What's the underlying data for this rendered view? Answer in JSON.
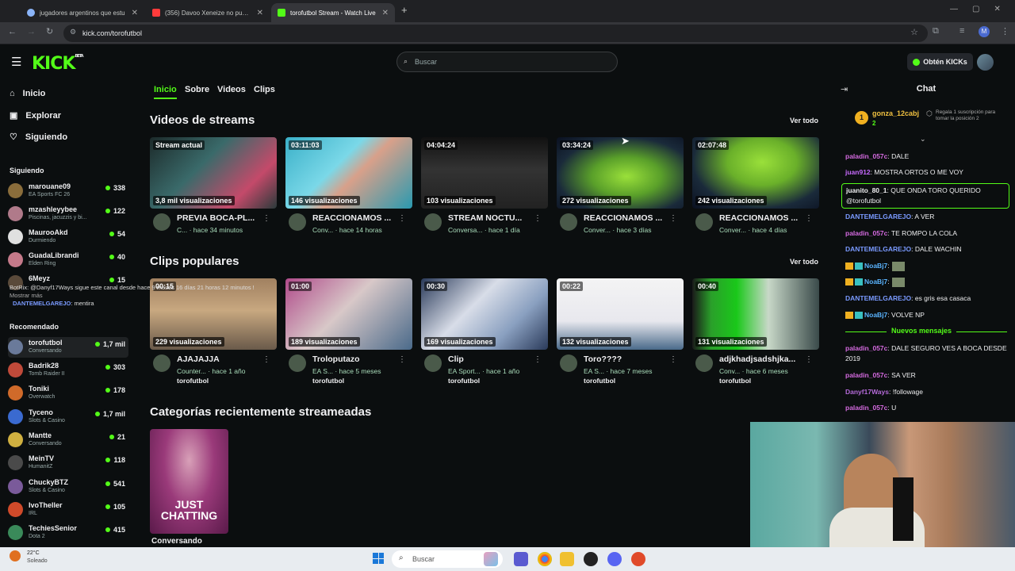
{
  "browser": {
    "tabs": [
      {
        "title": "jugadores argentinos que estu",
        "color": "#8ab4f8"
      },
      {
        "title": "(356) Davoo Xeneize no puede",
        "color": "#ff3b3b"
      },
      {
        "title": "torofutbol Stream - Watch Live",
        "color": "#53fc18"
      }
    ],
    "url": "kick.com/torofutbol"
  },
  "header": {
    "logo": "KICK",
    "beta": "BETA",
    "search_placeholder": "Buscar",
    "get_kicks": "Obtén KICKs"
  },
  "sidebar": {
    "nav": [
      {
        "label": "Inicio",
        "icon": "home-icon"
      },
      {
        "label": "Explorar",
        "icon": "compass-icon"
      },
      {
        "label": "Siguiendo",
        "icon": "heart-icon"
      }
    ],
    "following_title": "Siguiendo",
    "following": [
      {
        "name": "marouane09",
        "sub": "EA Sports FC 26",
        "viewers": "338",
        "color": "#8a6d3b"
      },
      {
        "name": "mzashleyybee",
        "sub": "Piscinas, jacuzzis y bi...",
        "viewers": "122",
        "color": "#b07a8a"
      },
      {
        "name": "MaurooAkd",
        "sub": "Durmiendo",
        "viewers": "54",
        "color": "#e0e0e0"
      },
      {
        "name": "GuadaLibrandi",
        "sub": "Elden Ring",
        "viewers": "40",
        "color": "#c57a8a"
      },
      {
        "name": "6Meyz",
        "sub": "",
        "viewers": "15",
        "color": "#5a4a3a"
      }
    ],
    "overlay_botrix": "BotRix: @Danyf17Ways sigue este canal desde hace 9 meses 16 días 21 horas 12 minutos !",
    "overlay_more": "Mostrar más",
    "overlay_user": "DANTEMELGAREJO",
    "overlay_text": ": mentira",
    "recommended_title": "Recomendado",
    "recommended": [
      {
        "name": "torofutbol",
        "sub": "Conversando",
        "viewers": "1,7 mil",
        "color": "#6a7a9a"
      },
      {
        "name": "Badrik28",
        "sub": "Tomb Raider II",
        "viewers": "303",
        "color": "#c04a3a"
      },
      {
        "name": "Toniki",
        "sub": "Overwatch",
        "viewers": "178",
        "color": "#d06a2a"
      },
      {
        "name": "Tyceno",
        "sub": "Slots & Casino",
        "viewers": "1,7 mil",
        "color": "#3a6ad0"
      },
      {
        "name": "Mantte",
        "sub": "Conversando",
        "viewers": "21",
        "color": "#d0b040"
      },
      {
        "name": "MeinTV",
        "sub": "HumanitZ",
        "viewers": "118",
        "color": "#4a4a4a"
      },
      {
        "name": "ChuckyBTZ",
        "sub": "Slots & Casino",
        "viewers": "541",
        "color": "#7a5a9a"
      },
      {
        "name": "IvoTheller",
        "sub": "IRL",
        "viewers": "105",
        "color": "#d04a2a"
      },
      {
        "name": "TechiesSenior",
        "sub": "Dota 2",
        "viewers": "415",
        "color": "#3a8a5a"
      }
    ]
  },
  "profile_tabs": [
    "Inicio",
    "Sobre",
    "Videos",
    "Clips"
  ],
  "videos_section": {
    "title": "Videos de streams",
    "see_all": "Ver todo",
    "items": [
      {
        "badge": "Stream actual",
        "views": "3,8 mil visualizaciones",
        "title": "PREVIA BOCA-PL...",
        "meta": "C... · hace 34 minutos",
        "bg": "linear-gradient(135deg,#1c2a2a 0%,#3a6a6a 40%,#c44a6a 75%,#2a3a3a 100%)"
      },
      {
        "badge": "03:11:03",
        "views": "146 visualizaciones",
        "title": "REACCIONAMOS ...",
        "meta": "Conv... · hace 14 horas",
        "bg": "linear-gradient(135deg,#3ab0c8 0%,#7ad8e8 40%,#d8a08a 55%,#2a9ab0 100%)"
      },
      {
        "badge": "04:04:24",
        "views": "103 visualizaciones",
        "title": "STREAM NOCTU...",
        "meta": "Conversa... · hace 1 día",
        "bg": "linear-gradient(180deg,#111 0%,#333 45%,#222 100%)"
      },
      {
        "badge": "03:34:24",
        "views": "272 visualizaciones",
        "title": "REACCIONAMOS ...",
        "meta": "Conver... · hace 3 días",
        "bg": "radial-gradient(ellipse at 55% 55%,#9ae03a 0%,#5aa02a 35%,#1a2a3a 70%,#0a1020 100%)"
      },
      {
        "badge": "02:07:48",
        "views": "242 visualizaciones",
        "title": "REACCIONAMOS ...",
        "meta": "Conver... · hace 4 días",
        "bg": "radial-gradient(ellipse at 55% 35%,#9ae03a 0%,#6ab02a 35%,#1a2a3a 70%,#0a1020 100%)"
      }
    ]
  },
  "clips_section": {
    "title": "Clips populares",
    "see_all": "Ver todo",
    "items": [
      {
        "badge": "00:15",
        "views": "229 visualizaciones",
        "title": "AJAJAJJA",
        "meta": "Counter... · hace 1 año",
        "user": "torofutbol",
        "bg": "linear-gradient(180deg,#a08060 0%,#c8a880 45%,#6a5a4a 100%)"
      },
      {
        "badge": "01:00",
        "views": "189 visualizaciones",
        "title": "Troloputazo",
        "meta": "EA S... · hace 5 meses",
        "user": "torofutbol",
        "bg": "linear-gradient(135deg,#b04a8a 0%,#d8c8c8 45%,#4a6a8a 100%)"
      },
      {
        "badge": "00:30",
        "views": "169 visualizaciones",
        "title": "Clip",
        "meta": "EA Sport... · hace 1 año",
        "user": "torofutbol",
        "bg": "linear-gradient(135deg,#2a3a5a 0%,#d8dde8 40%,#8aa0c0 70%,#2a3a5a 100%)"
      },
      {
        "badge": "00:22",
        "views": "132 visualizaciones",
        "title": "Toro????",
        "meta": "EA S... · hace 7 meses",
        "user": "torofutbol",
        "bg": "linear-gradient(180deg,#f4f4f4 0%,#e8e8ee 60%,#4a6a8a 100%)"
      },
      {
        "badge": "00:40",
        "views": "131 visualizaciones",
        "title": "adjkhadjsadshjka...",
        "meta": "Conv... · hace 6 meses",
        "user": "torofutbol",
        "bg": "linear-gradient(90deg,#1a1a1a 0%,#2aa02a 15%,#1ac81a 35%,#c8d8c8 60%,#3a4a4a 100%)"
      }
    ]
  },
  "categories_section": {
    "title": "Categorías recientemente streameadas",
    "items": [
      {
        "name": "Conversando",
        "art_text": "JUST CHATTING"
      }
    ]
  },
  "chat": {
    "title": "Chat",
    "top_gifter": {
      "rank": "1",
      "name": "gonza_12cabj",
      "count": "2",
      "promo": "Regala 1 suscripción para tomar la posición 2"
    },
    "messages": [
      {
        "user": "paladin_057c",
        "text": ": DALE",
        "color": "#d46adf"
      },
      {
        "user": "juan912",
        "text": ": MOSTRA ORTOS O ME VOY",
        "color": "#c86aff"
      },
      {
        "user": "juanito_80_1",
        "text": ": QUE ONDA TORO QUERIDO @torofutbol",
        "color": "#efeff1",
        "highlight": true
      },
      {
        "user": "DANTEMELGAREJO",
        "text": ": A VER",
        "color": "#7a9aff"
      },
      {
        "user": "paladin_057c",
        "text": ": TE ROMPO LA COLA",
        "color": "#d46adf"
      },
      {
        "user": "DANTEMELGAREJO",
        "text": ": DALE WACHIN",
        "color": "#7a9aff"
      },
      {
        "user": "NoaBj7",
        "text": ":",
        "color": "#5ab4ff"
      },
      {
        "user": "NoaBj7",
        "text": ":",
        "color": "#5ab4ff"
      },
      {
        "user": "DANTEMELGAREJO",
        "text": ": es gris esa casaca",
        "color": "#7a9aff"
      },
      {
        "user": "NoaBj7",
        "text": ": VOLVE NP",
        "color": "#5ab4ff"
      },
      {
        "user": "paladin_057c",
        "text": ": DALE SEGURO VES A BOCA DESDE 2019",
        "color": "#d46adf"
      },
      {
        "user": "paladin_057c",
        "text": ": SA VER",
        "color": "#d46adf"
      },
      {
        "user": "Danyf17Ways",
        "text": ": !followage",
        "color": "#b46ad8"
      },
      {
        "user": "paladin_057c",
        "text": ": U",
        "color": "#d46adf"
      }
    ],
    "new_messages": "Nuevos mensajes"
  },
  "taskbar": {
    "weather_temp": "22°C",
    "weather_desc": "Soleado",
    "search_placeholder": "Buscar"
  },
  "colors": {
    "accent": "#53fc18",
    "background": "#0b0e0f"
  }
}
